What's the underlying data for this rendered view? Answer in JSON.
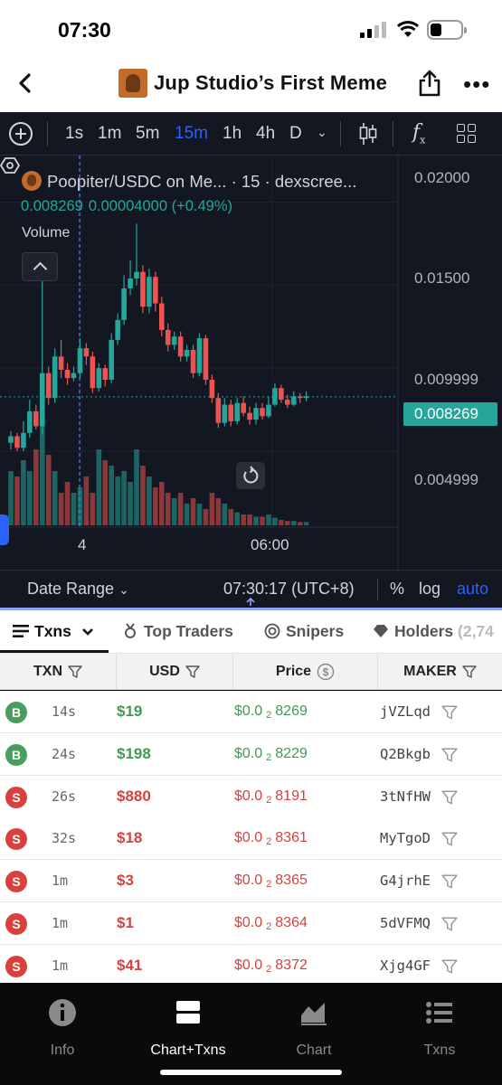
{
  "status": {
    "time": "07:30"
  },
  "header": {
    "title": "Jup Studio’s First Meme"
  },
  "toolbar": {
    "timeframes": [
      "1s",
      "1m",
      "5m",
      "15m",
      "1h",
      "4h",
      "D"
    ],
    "active_timeframe": "15m"
  },
  "chart": {
    "legend_title": "Poopiter/USDC on Me... · 15 · dexscree...",
    "legend_price": "0.008269",
    "legend_change": "0.00004000 (+0.49%)",
    "volume_label": "Volume",
    "price_axis": [
      "0.02000",
      "0.01500",
      "0.009999",
      "0.004999"
    ],
    "last_price_tag": "0.008269",
    "time_axis": [
      "4",
      "06:00"
    ]
  },
  "chart_data": {
    "type": "candlestick",
    "title": "Poopiter/USDC",
    "ylim": [
      0.0032,
      0.0215
    ],
    "y_ticks": [
      0.004999,
      0.009999,
      0.015,
      0.02
    ],
    "x_ticks": [
      "4",
      "06:00"
    ],
    "last_price": 0.008269,
    "candles": [
      [
        0.0055,
        0.0059,
        0.0062,
        0.0051
      ],
      [
        0.0059,
        0.0052,
        0.0061,
        0.005
      ],
      [
        0.0052,
        0.0061,
        0.0068,
        0.005
      ],
      [
        0.0061,
        0.0074,
        0.0081,
        0.0058
      ],
      [
        0.0074,
        0.0065,
        0.0078,
        0.0063
      ],
      [
        0.0065,
        0.0097,
        0.0166,
        0.006
      ],
      [
        0.0097,
        0.0082,
        0.0101,
        0.0078
      ],
      [
        0.0082,
        0.0107,
        0.0112,
        0.0079
      ],
      [
        0.0107,
        0.0099,
        0.0117,
        0.0094
      ],
      [
        0.0099,
        0.0094,
        0.0103,
        0.009
      ],
      [
        0.0094,
        0.0097,
        0.0101,
        0.0092
      ],
      [
        0.0097,
        0.0112,
        0.0118,
        0.0094
      ],
      [
        0.0112,
        0.0107,
        0.0115,
        0.0102
      ],
      [
        0.0107,
        0.0088,
        0.011,
        0.0085
      ],
      [
        0.0088,
        0.01,
        0.0103,
        0.0086
      ],
      [
        0.01,
        0.0093,
        0.0102,
        0.0089
      ],
      [
        0.0093,
        0.0117,
        0.0121,
        0.0091
      ],
      [
        0.0117,
        0.0129,
        0.0133,
        0.0114
      ],
      [
        0.0129,
        0.0148,
        0.0156,
        0.0126
      ],
      [
        0.0148,
        0.0154,
        0.0165,
        0.0144
      ],
      [
        0.0154,
        0.0158,
        0.0187,
        0.015
      ],
      [
        0.0158,
        0.0137,
        0.0162,
        0.0133
      ],
      [
        0.0137,
        0.0155,
        0.016,
        0.0133
      ],
      [
        0.0155,
        0.0139,
        0.0158,
        0.0134
      ],
      [
        0.0139,
        0.0123,
        0.0143,
        0.0119
      ],
      [
        0.0123,
        0.0114,
        0.0127,
        0.011
      ],
      [
        0.0114,
        0.0119,
        0.0122,
        0.0111
      ],
      [
        0.0119,
        0.0107,
        0.0122,
        0.0104
      ],
      [
        0.0107,
        0.0111,
        0.0114,
        0.0104
      ],
      [
        0.0111,
        0.0097,
        0.0114,
        0.0094
      ],
      [
        0.0097,
        0.0118,
        0.0121,
        0.0095
      ],
      [
        0.0118,
        0.0093,
        0.012,
        0.009
      ],
      [
        0.0093,
        0.0082,
        0.0096,
        0.0079
      ],
      [
        0.0082,
        0.0067,
        0.0085,
        0.0064
      ],
      [
        0.0067,
        0.0078,
        0.0082,
        0.0065
      ],
      [
        0.0078,
        0.0068,
        0.0081,
        0.0065
      ],
      [
        0.0068,
        0.0079,
        0.0082,
        0.0066
      ],
      [
        0.0079,
        0.0073,
        0.0083,
        0.0071
      ],
      [
        0.0073,
        0.0069,
        0.0077,
        0.0066
      ],
      [
        0.0069,
        0.0076,
        0.0079,
        0.0066
      ],
      [
        0.0076,
        0.0071,
        0.0079,
        0.0069
      ],
      [
        0.0071,
        0.0078,
        0.0083,
        0.007
      ],
      [
        0.0078,
        0.0088,
        0.0091,
        0.0077
      ],
      [
        0.0088,
        0.0081,
        0.009,
        0.0079
      ],
      [
        0.0081,
        0.0078,
        0.0084,
        0.0076
      ],
      [
        0.0078,
        0.0083,
        0.0086,
        0.0077
      ],
      [
        0.0083,
        0.0082,
        0.0085,
        0.0079
      ],
      [
        0.0082,
        0.0083,
        0.0086,
        0.008
      ]
    ],
    "volume_relative": [
      0.5,
      0.45,
      0.6,
      0.5,
      0.7,
      1.0,
      0.65,
      0.5,
      0.3,
      0.4,
      0.3,
      0.35,
      0.45,
      0.3,
      0.7,
      0.6,
      0.55,
      0.45,
      0.5,
      0.4,
      0.7,
      0.55,
      0.45,
      0.35,
      0.4,
      0.3,
      0.25,
      0.3,
      0.2,
      0.25,
      0.2,
      0.15,
      0.3,
      0.25,
      0.2,
      0.15,
      0.12,
      0.1,
      0.1,
      0.08,
      0.08,
      0.1,
      0.07,
      0.05,
      0.04,
      0.04,
      0.03,
      0.03
    ]
  },
  "chartbar": {
    "date_range": "Date Range",
    "clock": "07:30:17 (UTC+8)",
    "percent": "%",
    "log": "log",
    "auto": "auto"
  },
  "tabs": {
    "txns": "Txns",
    "top_traders": "Top Traders",
    "snipers": "Snipers",
    "holders": "Holders",
    "holders_count": "(2,74"
  },
  "table": {
    "headers": {
      "txn": "TXN",
      "usd": "USD",
      "price": "Price",
      "maker": "MAKER"
    },
    "rows": [
      {
        "side": "B",
        "age": "14s",
        "usd": "$19",
        "price_prefix": "$0.0",
        "price_zeros": "2",
        "price_digits": "8269",
        "maker": "jVZLqd"
      },
      {
        "side": "B",
        "age": "24s",
        "usd": "$198",
        "price_prefix": "$0.0",
        "price_zeros": "2",
        "price_digits": "8229",
        "maker": "Q2Bkgb"
      },
      {
        "side": "S",
        "age": "26s",
        "usd": "$880",
        "price_prefix": "$0.0",
        "price_zeros": "2",
        "price_digits": "8191",
        "maker": "3tNfHW"
      },
      {
        "side": "S",
        "age": "32s",
        "usd": "$18",
        "price_prefix": "$0.0",
        "price_zeros": "2",
        "price_digits": "8361",
        "maker": "MyTgoD"
      },
      {
        "side": "S",
        "age": "1m",
        "usd": "$3",
        "price_prefix": "$0.0",
        "price_zeros": "2",
        "price_digits": "8365",
        "maker": "G4jrhE"
      },
      {
        "side": "S",
        "age": "1m",
        "usd": "$1",
        "price_prefix": "$0.0",
        "price_zeros": "2",
        "price_digits": "8364",
        "maker": "5dVFMQ"
      },
      {
        "side": "S",
        "age": "1m",
        "usd": "$41",
        "price_prefix": "$0.0",
        "price_zeros": "2",
        "price_digits": "8372",
        "maker": "Xjg4GF"
      }
    ]
  },
  "bottomnav": {
    "items": [
      "Info",
      "Chart+Txns",
      "Chart",
      "Txns"
    ],
    "active": "Chart+Txns"
  },
  "colors": {
    "up": "#26a69a",
    "down": "#ef5350",
    "accent": "#2962ff",
    "buy": "#4a9e5c",
    "sell": "#d9413d"
  }
}
